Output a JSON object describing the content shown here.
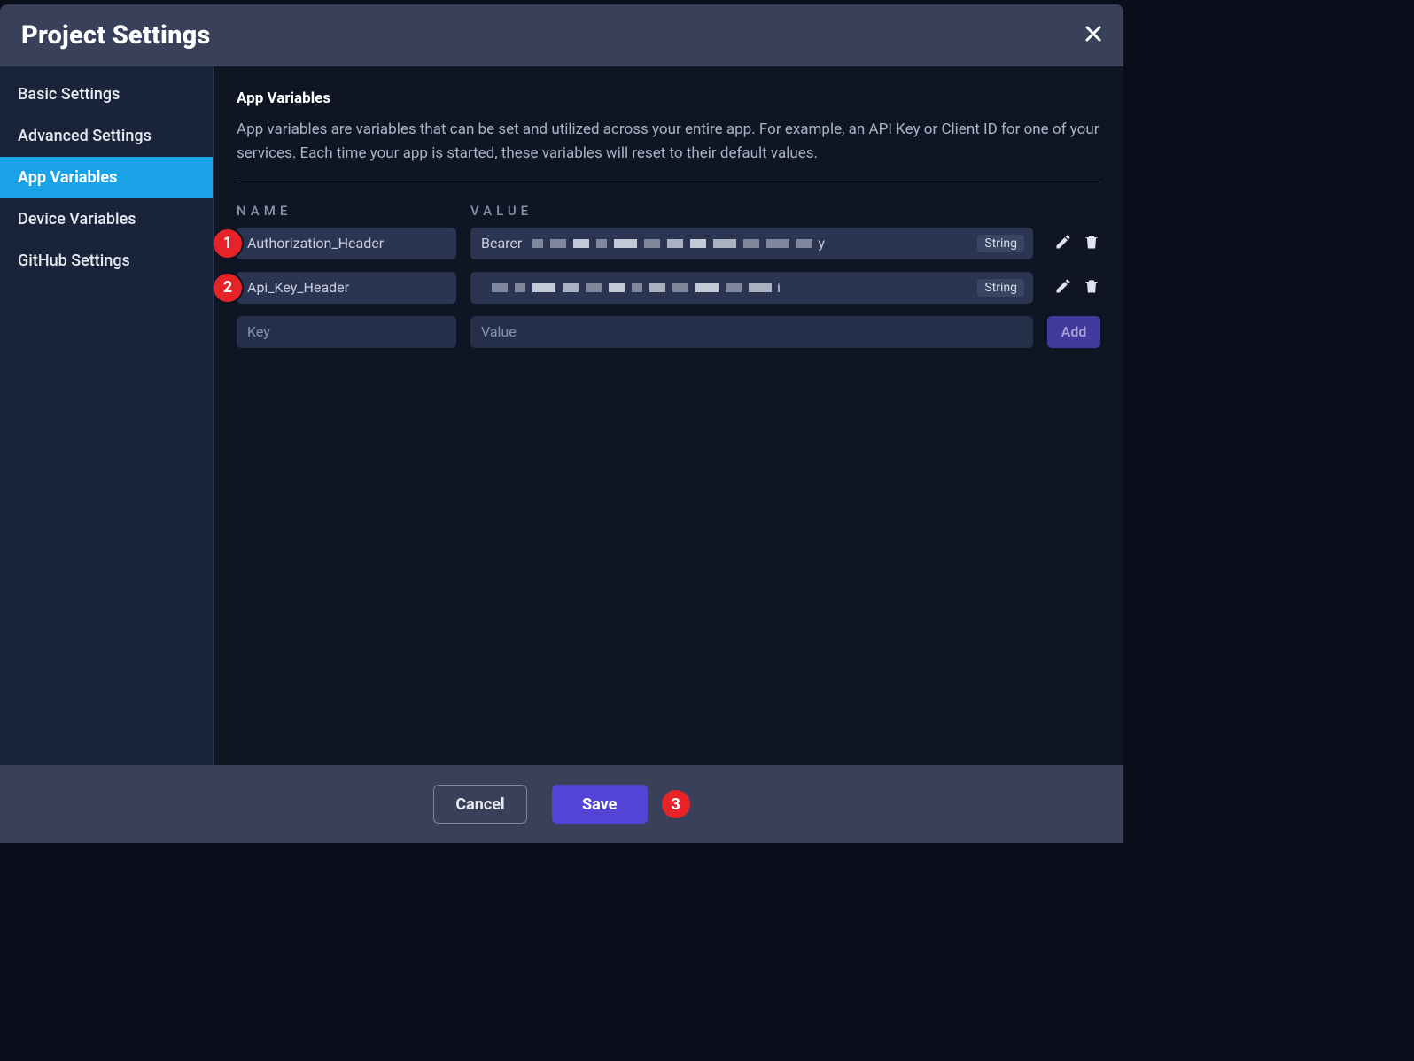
{
  "dialog": {
    "title": "Project Settings"
  },
  "sidebar": {
    "items": [
      {
        "label": "Basic Settings",
        "active": false
      },
      {
        "label": "Advanced Settings",
        "active": false
      },
      {
        "label": "App Variables",
        "active": true
      },
      {
        "label": "Device Variables",
        "active": false
      },
      {
        "label": "GitHub Settings",
        "active": false
      }
    ]
  },
  "main": {
    "section_title": "App Variables",
    "section_desc": "App variables are variables that can be set and utilized across your entire app. For example, an API Key or Client ID for one of your services. Each time your app is started, these variables will reset to their default values.",
    "columns": {
      "name": "NAME",
      "value": "VALUE"
    },
    "variables": [
      {
        "marker": "1",
        "name": "Authorization_Header",
        "value_prefix": "Bearer ",
        "value_suffix": "y",
        "type": "String"
      },
      {
        "marker": "2",
        "name": "Api_Key_Header",
        "value_prefix": "",
        "value_suffix": "i",
        "type": "String"
      }
    ],
    "new_row": {
      "key_placeholder": "Key",
      "value_placeholder": "Value",
      "add_label": "Add"
    }
  },
  "footer": {
    "cancel_label": "Cancel",
    "save_label": "Save",
    "save_marker": "3"
  }
}
